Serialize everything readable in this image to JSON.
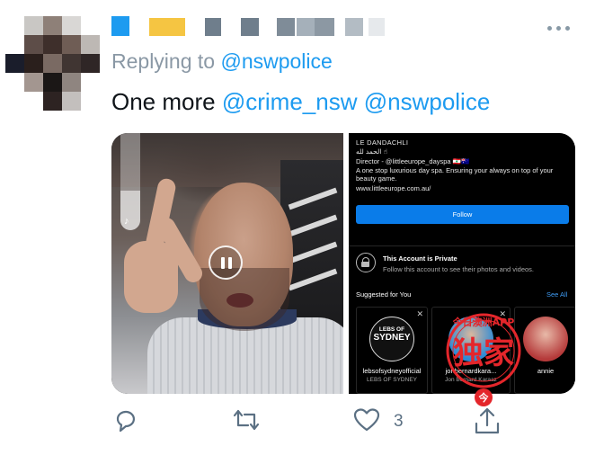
{
  "tweet": {
    "reply_prefix": "Replying to",
    "reply_mention": "@nswpolice",
    "text_main": "One more",
    "mention_1": "@crime_nsw",
    "mention_2": "@nswpolice",
    "like_count": "3"
  },
  "instagram_screenshot": {
    "profile_name": "LE DANDACHLI",
    "arabic_line": "الحمد لله ☝",
    "bio_line_1": "Director - @littleeurope_dayspa 🇱🇧🇦🇺",
    "bio_line_2": "A one stop luxurious day spa. Ensuring your always on top of your",
    "bio_line_3": "beauty game.",
    "website": "www.littleeurope.com.au/",
    "follow_label": "Follow",
    "private_title": "This Account is Private",
    "private_subtitle": "Follow this account to see their photos and videos.",
    "suggested_label": "Suggested for You",
    "see_all_label": "See All",
    "cards": [
      {
        "logo_top": "LEBS OF",
        "logo_big": "SYDNEY",
        "username": "lebsofsydneyofficial",
        "subname": "LEBS OF SYDNEY"
      },
      {
        "username": "jonbernardkara...",
        "subname": "Jon Bernard Karaaz"
      },
      {
        "username": "annie",
        "subname": ""
      }
    ]
  },
  "watermark": {
    "arc_text": "今日澳洲APP",
    "big_text": "独家",
    "small_text": "今"
  },
  "colors": {
    "accent": "#1d9bf0",
    "muted": "#5b7083",
    "ig_follow": "#0a7ce9",
    "seal_red": "#e4262b"
  },
  "icons": [
    "more-icon",
    "reply-icon",
    "retweet-icon",
    "like-icon",
    "share-icon",
    "pause-icon",
    "lock-icon",
    "audio-icon"
  ]
}
